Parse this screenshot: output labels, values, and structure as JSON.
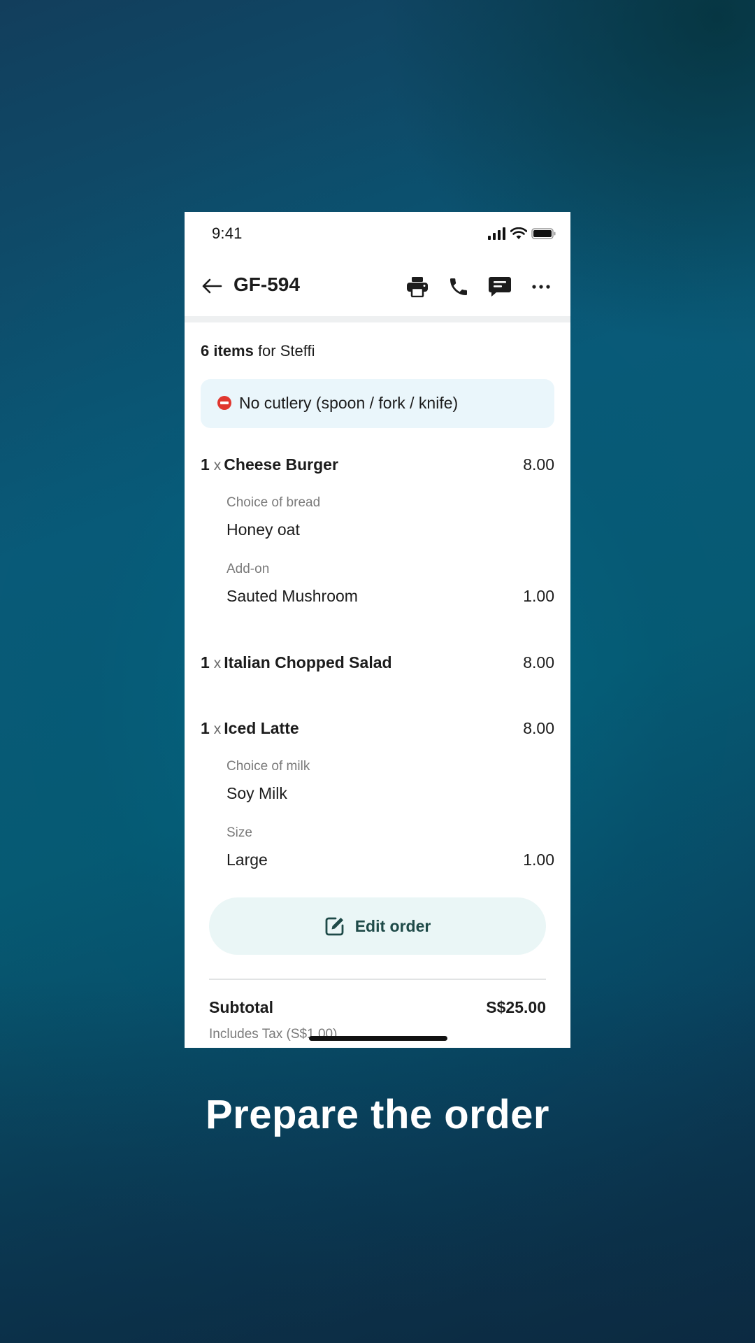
{
  "background": {
    "accent": "#0a5a78",
    "dark": "#0b2f47"
  },
  "status_bar": {
    "time": "9:41"
  },
  "header": {
    "title": "GF-594",
    "icons": [
      "back-arrow-icon",
      "printer-icon",
      "phone-icon",
      "chat-icon",
      "more-icon"
    ]
  },
  "summary": {
    "count_text": "6 items",
    "for_text": " for Steffi"
  },
  "note": {
    "icon": "no-entry-icon",
    "text": "No cutlery (spoon / fork / knife)"
  },
  "items": [
    {
      "qty": "1",
      "x": "x",
      "name": "Cheese Burger",
      "price": "8.00",
      "options": [
        {
          "label": "Choice of bread",
          "value": "Honey oat",
          "price": ""
        },
        {
          "label": "Add-on",
          "value": "Sauted Mushroom",
          "price": "1.00"
        }
      ]
    },
    {
      "qty": "1",
      "x": "x",
      "name": "Italian Chopped Salad",
      "price": "8.00",
      "options": []
    },
    {
      "qty": "1",
      "x": "x",
      "name": "Iced Latte",
      "price": "8.00",
      "options": [
        {
          "label": "Choice of milk",
          "value": "Soy Milk",
          "price": ""
        },
        {
          "label": "Size",
          "value": "Large",
          "price": "1.00"
        }
      ]
    }
  ],
  "edit_button": {
    "label": "Edit order",
    "icon": "edit-icon"
  },
  "totals": {
    "subtotal_label": "Subtotal",
    "subtotal_value": "S$25.00",
    "tax_note": "Includes Tax (S$1.00)"
  },
  "caption": "Prepare the order"
}
